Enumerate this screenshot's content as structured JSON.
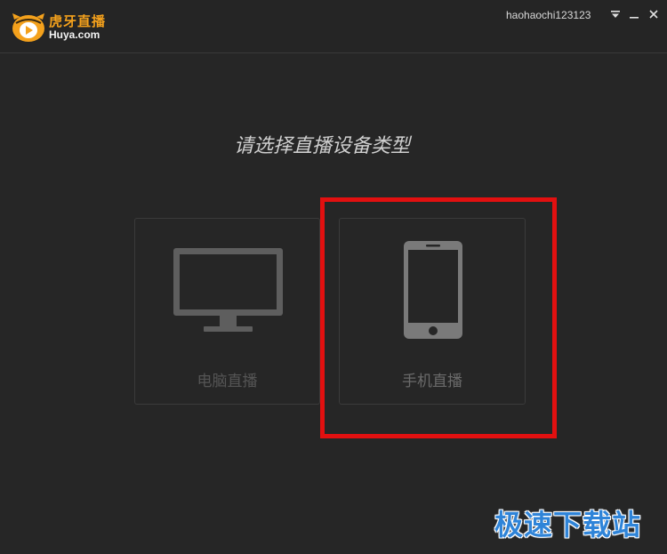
{
  "app": {
    "logo_cn": "虎牙直播",
    "logo_en": "Huya.com",
    "brand_color": "#f4a11c"
  },
  "header": {
    "username": "haohaochi123123",
    "controls": [
      "menu-icon",
      "minimize-icon",
      "close-icon"
    ]
  },
  "main": {
    "prompt": "请选择直播设备类型",
    "options": [
      {
        "label": "电脑直播",
        "icon": "monitor-icon"
      },
      {
        "label": "手机直播",
        "icon": "smartphone-icon"
      }
    ],
    "highlight_color": "#e21010"
  },
  "watermark": {
    "text": "极速下载站",
    "color": "#2f84d8"
  }
}
